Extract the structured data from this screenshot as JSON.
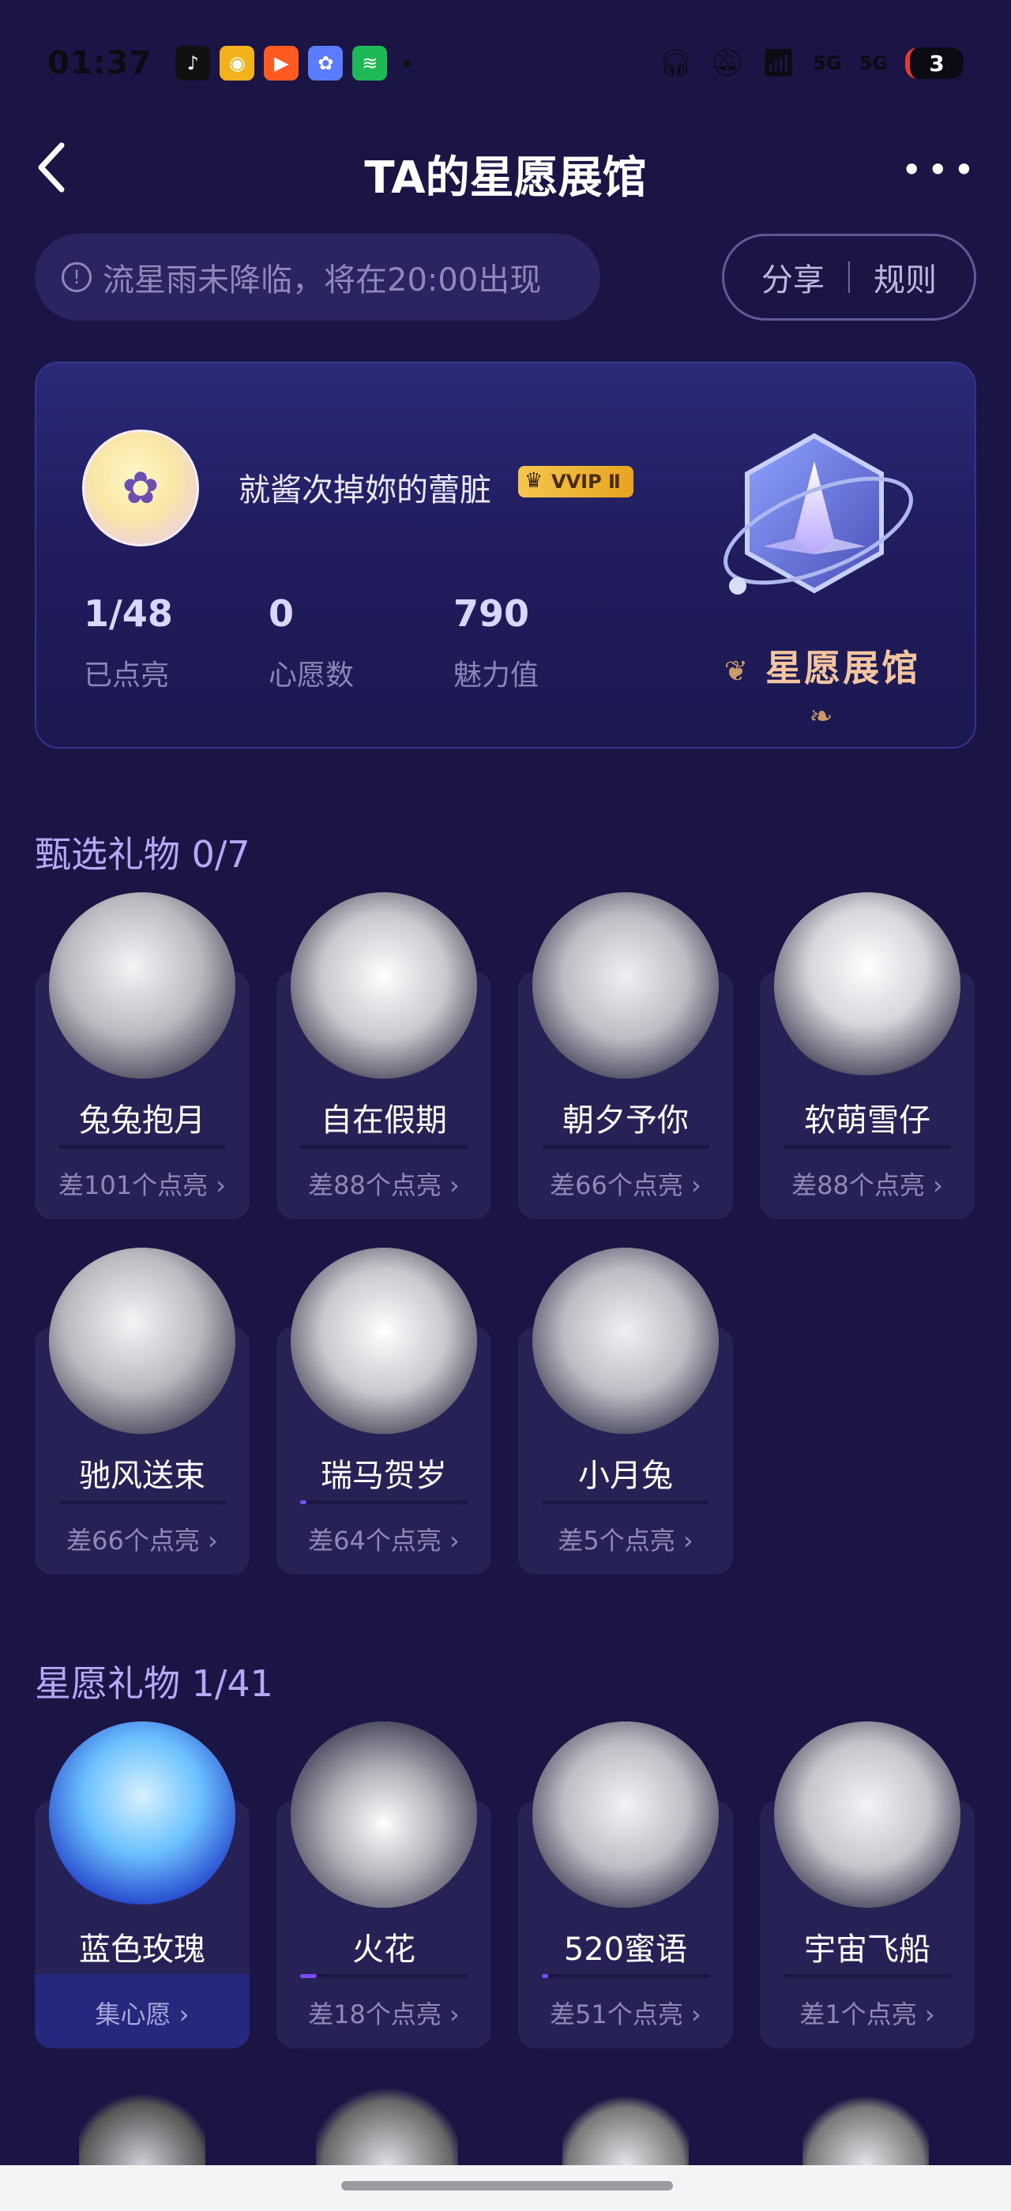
{
  "status_bar": {
    "time": "01:37",
    "apps": [
      {
        "name": "tiktok-icon",
        "glyph": "♪",
        "color": "#111111"
      },
      {
        "name": "weibo-icon",
        "glyph": "◉",
        "color": "#f3b21c"
      },
      {
        "name": "kuaishou-icon",
        "glyph": "▶",
        "color": "#ff5a1f"
      },
      {
        "name": "gallery-icon",
        "glyph": "✿",
        "color": "#5b7cff"
      },
      {
        "name": "spotify-icon",
        "glyph": "≋",
        "color": "#1db954"
      }
    ],
    "signal": "5G",
    "battery": "3"
  },
  "header": {
    "title": "TA的星愿展馆"
  },
  "notice": {
    "text": "流星雨未降临，将在20:00出现"
  },
  "actions": {
    "share": "分享",
    "rules": "规则"
  },
  "profile": {
    "username": "就酱次掉妳的蕾脏",
    "vip_label": "VVIP Ⅱ",
    "stats": [
      {
        "value": "1/48",
        "label": "已点亮"
      },
      {
        "value": "0",
        "label": "心愿数"
      },
      {
        "value": "790",
        "label": "魅力值"
      }
    ],
    "badge_title": "星愿展馆"
  },
  "featured": {
    "title": "甄选礼物 0/7",
    "gifts": [
      {
        "name": "兔兔抱月",
        "status": "差101个点亮",
        "progress": 0
      },
      {
        "name": "自在假期",
        "status": "差88个点亮",
        "progress": 0
      },
      {
        "name": "朝夕予你",
        "status": "差66个点亮",
        "progress": 0
      },
      {
        "name": "软萌雪仔",
        "status": "差88个点亮",
        "progress": 0
      },
      {
        "name": "驰风送束",
        "status": "差66个点亮",
        "progress": 0
      },
      {
        "name": "瑞马贺岁",
        "status": "差64个点亮",
        "progress": 0.02
      },
      {
        "name": "小月兔",
        "status": "差5个点亮",
        "progress": 0
      }
    ]
  },
  "wish": {
    "title": "星愿礼物 1/41",
    "gifts": [
      {
        "name": "蓝色玫瑰",
        "status": "集心愿",
        "progress": 1
      },
      {
        "name": "火花",
        "status": "差18个点亮",
        "progress": 0.1
      },
      {
        "name": "520蜜语",
        "status": "差51个点亮",
        "progress": 0.02
      },
      {
        "name": "宇宙飞船",
        "status": "差1个点亮",
        "progress": 0
      }
    ]
  }
}
